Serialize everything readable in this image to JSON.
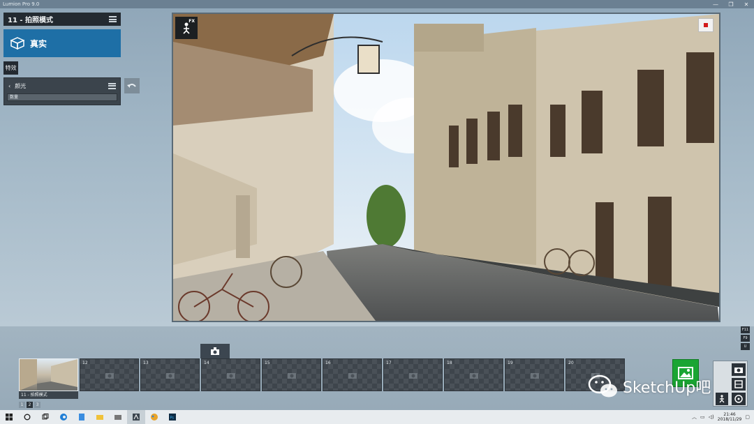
{
  "window": {
    "title": "Lumion Pro 9.0",
    "controls": [
      "—",
      "❐",
      "✕"
    ]
  },
  "left_panel": {
    "mode_title": "11 - 拍照模式",
    "style_label": "真实",
    "fx_tab_label": "特效",
    "effect": {
      "name": "颜光",
      "slider_label": "数量"
    }
  },
  "viewport": {
    "fx_label": "FX"
  },
  "bottom": {
    "keys": [
      "F11",
      "F9",
      "U"
    ],
    "thumbnails": [
      {
        "num": "",
        "active": true
      },
      {
        "num": "12"
      },
      {
        "num": "13"
      },
      {
        "num": "14"
      },
      {
        "num": "15"
      },
      {
        "num": "16"
      },
      {
        "num": "17"
      },
      {
        "num": "18"
      },
      {
        "num": "19"
      },
      {
        "num": "20"
      }
    ],
    "active_caption": "11 - 拍照模式",
    "pages": [
      "1",
      "2",
      "3"
    ],
    "current_page": "2"
  },
  "watermark": {
    "text": "SketchUp吧"
  },
  "taskbar": {
    "time": "21:46",
    "date": "2018/11/29",
    "apps": [
      "start-icon",
      "search-icon",
      "taskview-icon",
      "edge-icon",
      "docs-icon",
      "explorer-icon",
      "folder-icon",
      "lumion-icon",
      "paint-icon",
      "photoshop-icon"
    ]
  },
  "colors": {
    "accent_blue": "#1e6fa6",
    "render_green": "#1aa533",
    "record_red": "#d21a1a"
  }
}
